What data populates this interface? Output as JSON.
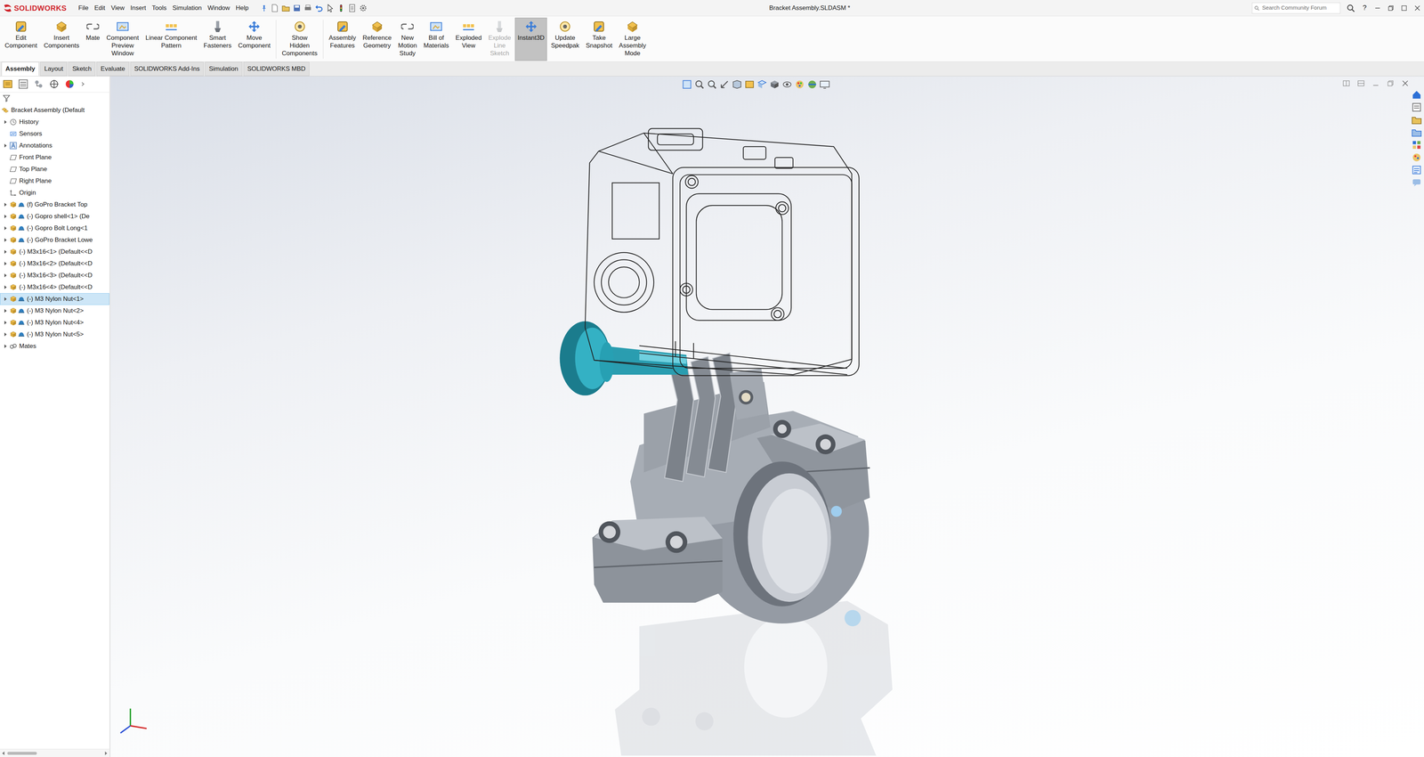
{
  "window": {
    "title": "Bracket Assembly.SLDASM *",
    "app": "SOLIDWORKS"
  },
  "menu": [
    "File",
    "Edit",
    "View",
    "Insert",
    "Tools",
    "Simulation",
    "Window",
    "Help"
  ],
  "search": {
    "placeholder": "Search Community Forum"
  },
  "help": "?",
  "ribbon": {
    "buttons": [
      {
        "lines": [
          "Edit",
          "Component"
        ],
        "selected": false,
        "disabled": false
      },
      {
        "lines": [
          "Insert",
          "Components"
        ],
        "selected": false,
        "disabled": false
      },
      {
        "lines": [
          "Mate"
        ],
        "selected": false,
        "disabled": false
      },
      {
        "lines": [
          "Component",
          "Preview",
          "Window"
        ],
        "selected": false,
        "disabled": false
      },
      {
        "lines": [
          "Linear Component",
          "Pattern"
        ],
        "selected": false,
        "disabled": false
      },
      {
        "lines": [
          "Smart",
          "Fasteners"
        ],
        "selected": false,
        "disabled": false
      },
      {
        "lines": [
          "Move",
          "Component"
        ],
        "selected": false,
        "disabled": false
      },
      {
        "lines": [
          "Show",
          "Hidden",
          "Components"
        ],
        "selected": false,
        "disabled": false
      },
      {
        "lines": [
          "Assembly",
          "Features"
        ],
        "selected": false,
        "disabled": false
      },
      {
        "lines": [
          "Reference",
          "Geometry"
        ],
        "selected": false,
        "disabled": false
      },
      {
        "lines": [
          "New",
          "Motion",
          "Study"
        ],
        "selected": false,
        "disabled": false
      },
      {
        "lines": [
          "Bill of",
          "Materials"
        ],
        "selected": false,
        "disabled": false
      },
      {
        "lines": [
          "Exploded",
          "View"
        ],
        "selected": false,
        "disabled": false
      },
      {
        "lines": [
          "Explode",
          "Line",
          "Sketch"
        ],
        "selected": false,
        "disabled": true
      },
      {
        "lines": [
          "Instant3D"
        ],
        "selected": true,
        "disabled": false
      },
      {
        "lines": [
          "Update",
          "Speedpak"
        ],
        "selected": false,
        "disabled": false
      },
      {
        "lines": [
          "Take",
          "Snapshot"
        ],
        "selected": false,
        "disabled": false
      },
      {
        "lines": [
          "Large",
          "Assembly",
          "Mode"
        ],
        "selected": false,
        "disabled": false
      }
    ]
  },
  "command_tabs": [
    {
      "label": "Assembly",
      "selected": true
    },
    {
      "label": "Layout",
      "selected": false
    },
    {
      "label": "Sketch",
      "selected": false
    },
    {
      "label": "Evaluate",
      "selected": false
    },
    {
      "label": "SOLIDWORKS Add-Ins",
      "selected": false
    },
    {
      "label": "Simulation",
      "selected": false
    },
    {
      "label": "SOLIDWORKS MBD",
      "selected": false
    }
  ],
  "tree": {
    "items": [
      {
        "label": "Bracket Assembly  (Default",
        "kind": "assembly",
        "expandable": false,
        "selected": false
      },
      {
        "label": "History",
        "kind": "history",
        "expandable": true,
        "selected": false
      },
      {
        "label": "Sensors",
        "kind": "sensor",
        "expandable": false,
        "selected": false
      },
      {
        "label": "Annotations",
        "kind": "annotation",
        "expandable": true,
        "selected": false
      },
      {
        "label": "Front Plane",
        "kind": "plane",
        "expandable": false,
        "selected": false
      },
      {
        "label": "Top Plane",
        "kind": "plane",
        "expandable": false,
        "selected": false
      },
      {
        "label": "Right Plane",
        "kind": "plane",
        "expandable": false,
        "selected": false
      },
      {
        "label": "Origin",
        "kind": "origin",
        "expandable": false,
        "selected": false
      },
      {
        "label": "(f) GoPro Bracket Top",
        "kind": "part",
        "expandable": true,
        "selected": false
      },
      {
        "label": "(-) Gopro shell<1> (De",
        "kind": "part",
        "expandable": true,
        "selected": false
      },
      {
        "label": "(-) Gopro Bolt Long<1",
        "kind": "part",
        "expandable": true,
        "selected": false
      },
      {
        "label": "(-) GoPro Bracket Lowe",
        "kind": "part",
        "expandable": true,
        "selected": false
      },
      {
        "label": "(-) M3x16<1> (Default<<D",
        "kind": "fastener",
        "expandable": true,
        "selected": false
      },
      {
        "label": "(-) M3x16<2> (Default<<D",
        "kind": "fastener",
        "expandable": true,
        "selected": false
      },
      {
        "label": "(-) M3x16<3> (Default<<D",
        "kind": "fastener",
        "expandable": true,
        "selected": false
      },
      {
        "label": "(-) M3x16<4> (Default<<D",
        "kind": "fastener",
        "expandable": true,
        "selected": false
      },
      {
        "label": "(-) M3 Nylon Nut<1>",
        "kind": "part",
        "expandable": true,
        "selected": true
      },
      {
        "label": "(-) M3 Nylon Nut<2>",
        "kind": "part",
        "expandable": true,
        "selected": false
      },
      {
        "label": "(-) M3 Nylon Nut<4>",
        "kind": "part",
        "expandable": true,
        "selected": false
      },
      {
        "label": "(-) M3 Nylon Nut<5>",
        "kind": "part",
        "expandable": true,
        "selected": false
      },
      {
        "label": "Mates",
        "kind": "mates",
        "expandable": true,
        "selected": false
      }
    ]
  }
}
